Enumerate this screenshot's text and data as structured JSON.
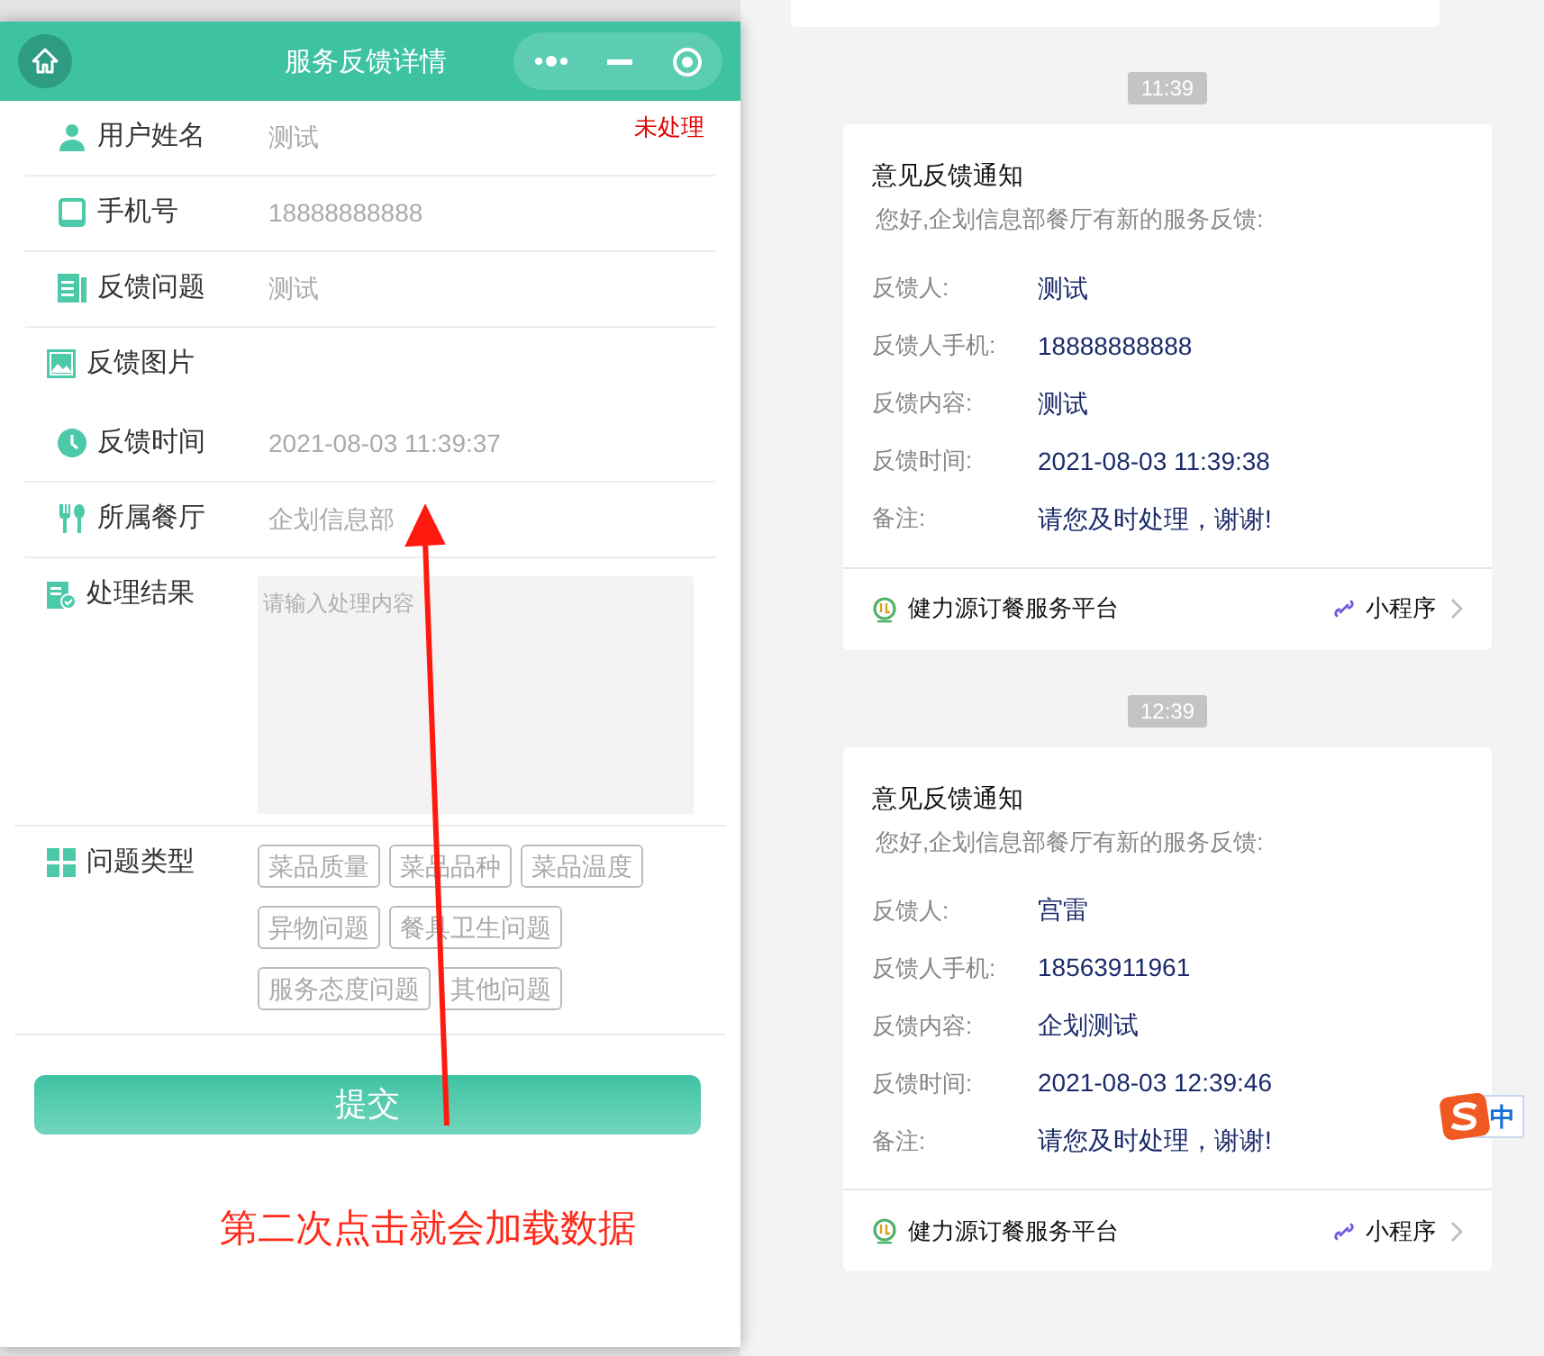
{
  "window": {
    "title": "服务反馈详情"
  },
  "form": {
    "rows": [
      {
        "kind": "text",
        "label": "用户姓名",
        "value": "测试",
        "status": "未处理"
      },
      {
        "kind": "text",
        "label": "手机号",
        "value": "18888888888"
      },
      {
        "kind": "text",
        "label": "反馈问题",
        "value": "测试"
      },
      {
        "kind": "image",
        "label": "反馈图片"
      },
      {
        "kind": "text",
        "label": "反馈时间",
        "value": "2021-08-03 11:39:37"
      },
      {
        "kind": "text",
        "label": "所属餐厅",
        "value": "企划信息部"
      },
      {
        "kind": "textarea",
        "label": "处理结果",
        "placeholder": "请输入处理内容"
      },
      {
        "kind": "tags",
        "label": "问题类型",
        "tags": [
          {
            "label": "菜品质量",
            "selected": false
          },
          {
            "label": "菜品品种",
            "selected": false
          },
          {
            "label": "菜品温度",
            "selected": false
          },
          {
            "label": "异物问题",
            "selected": false
          },
          {
            "label": "餐具卫生问题",
            "selected": false
          },
          {
            "label": "服务态度问题",
            "selected": false
          },
          {
            "label": "其他问题",
            "selected": false
          }
        ]
      }
    ],
    "submit": "提交"
  },
  "annotation": "第二次点击就会加载数据",
  "messages": [
    {
      "time": "11:39",
      "title": "意见反馈通知",
      "greeting": "您好,企划信息部餐厅有新的服务反馈:",
      "fields": [
        {
          "label": "反馈人:",
          "value": "测试"
        },
        {
          "label": "反馈人手机:",
          "value": "18888888888"
        },
        {
          "label": "反馈内容:",
          "value": "测试"
        },
        {
          "label": "反馈时间:",
          "value": "2021-08-03 11:39:38"
        },
        {
          "label": "备注:",
          "value": "请您及时处理，谢谢!"
        }
      ],
      "app_name": "健力源订餐服务平台",
      "link": "小程序"
    },
    {
      "time": "12:39",
      "title": "意见反馈通知",
      "greeting": "您好,企划信息部餐厅有新的服务反馈:",
      "fields": [
        {
          "label": "反馈人:",
          "value": "宫雷"
        },
        {
          "label": "反馈人手机:",
          "value": "18563911961"
        },
        {
          "label": "反馈内容:",
          "value": "企划测试"
        },
        {
          "label": "反馈时间:",
          "value": "2021-08-03 12:39:46"
        },
        {
          "label": "备注:",
          "value": "请您及时处理，谢谢!"
        }
      ],
      "app_name": "健力源订餐服务平台",
      "link": "小程序"
    }
  ],
  "ime": {
    "mode": "中"
  }
}
